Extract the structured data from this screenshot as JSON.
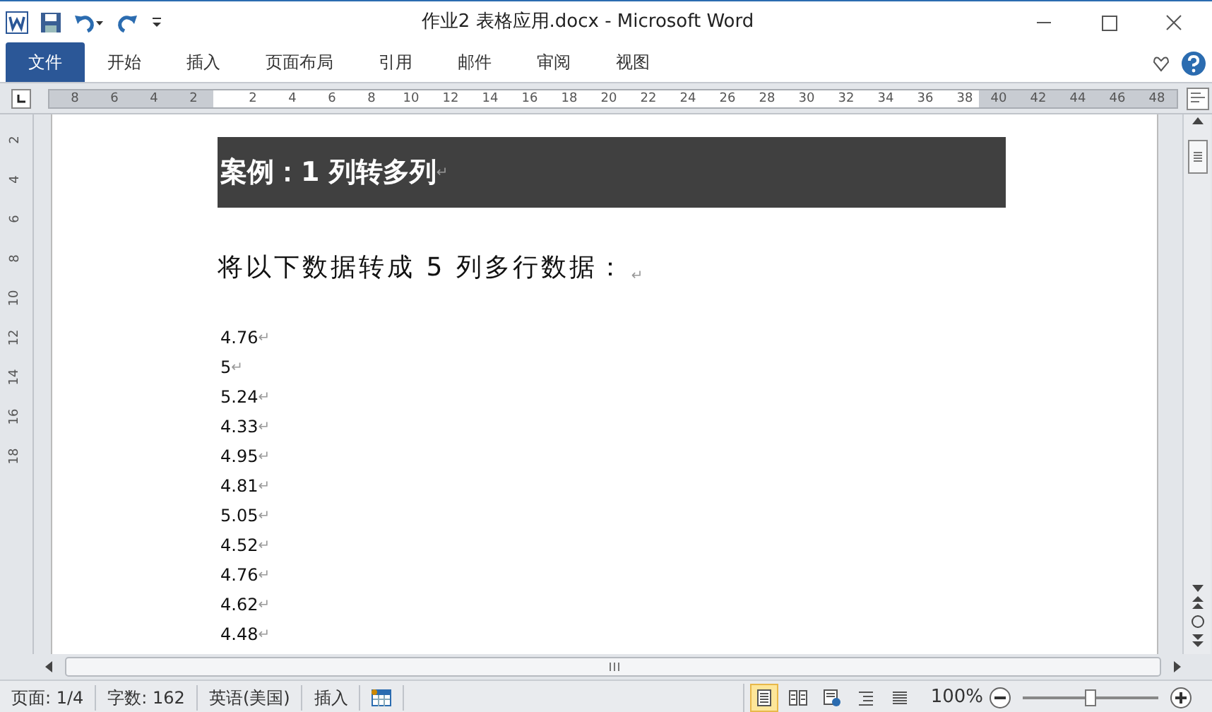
{
  "window": {
    "title": "作业2 表格应用.docx - Microsoft Word"
  },
  "ribbon_tabs": [
    {
      "label": "文件",
      "selected": true
    },
    {
      "label": "开始",
      "selected": false
    },
    {
      "label": "插入",
      "selected": false
    },
    {
      "label": "页面布局",
      "selected": false
    },
    {
      "label": "引用",
      "selected": false
    },
    {
      "label": "邮件",
      "selected": false
    },
    {
      "label": "审阅",
      "selected": false
    },
    {
      "label": "视图",
      "selected": false
    }
  ],
  "ruler": {
    "left_numbers": [
      "8",
      "6",
      "4",
      "2"
    ],
    "right_numbers": [
      "2",
      "4",
      "6",
      "8",
      "10",
      "12",
      "14",
      "16",
      "18",
      "20",
      "22",
      "24",
      "26",
      "28",
      "30",
      "32",
      "34",
      "36",
      "38",
      "40",
      "42",
      "44",
      "46",
      "48"
    ],
    "vertical_numbers": [
      "2",
      "4",
      "6",
      "8",
      "10",
      "12",
      "14",
      "16",
      "18"
    ]
  },
  "document": {
    "heading": {
      "text": "案例：1 列转多列",
      "end_mark": "↵"
    },
    "subheading": {
      "text": "将以下数据转成 5 列多行数据：",
      "end_mark": "↵"
    },
    "lines": [
      {
        "text": "4.76",
        "end_mark": "↵"
      },
      {
        "text": "5",
        "end_mark": "↵"
      },
      {
        "text": "5.24",
        "end_mark": "↵"
      },
      {
        "text": "4.33",
        "end_mark": "↵"
      },
      {
        "text": "4.95",
        "end_mark": "↵"
      },
      {
        "text": "4.81",
        "end_mark": "↵"
      },
      {
        "text": "5.05",
        "end_mark": "↵"
      },
      {
        "text": "4.52",
        "end_mark": "↵"
      },
      {
        "text": "4.76",
        "end_mark": "↵"
      },
      {
        "text": "4.62",
        "end_mark": "↵"
      },
      {
        "text": "4.48",
        "end_mark": "↵"
      }
    ]
  },
  "status_bar": {
    "items": [
      "页面: 1/4",
      "字数: 162",
      "英语(美国)",
      "插入"
    ],
    "views": [
      {
        "kind": "print",
        "selected": true
      },
      {
        "kind": "reading",
        "selected": false
      },
      {
        "kind": "web",
        "selected": false
      },
      {
        "kind": "outline",
        "selected": false
      },
      {
        "kind": "draft",
        "selected": false
      }
    ],
    "zoom": "100%",
    "zoom_slider": {
      "level": 0.5
    }
  }
}
